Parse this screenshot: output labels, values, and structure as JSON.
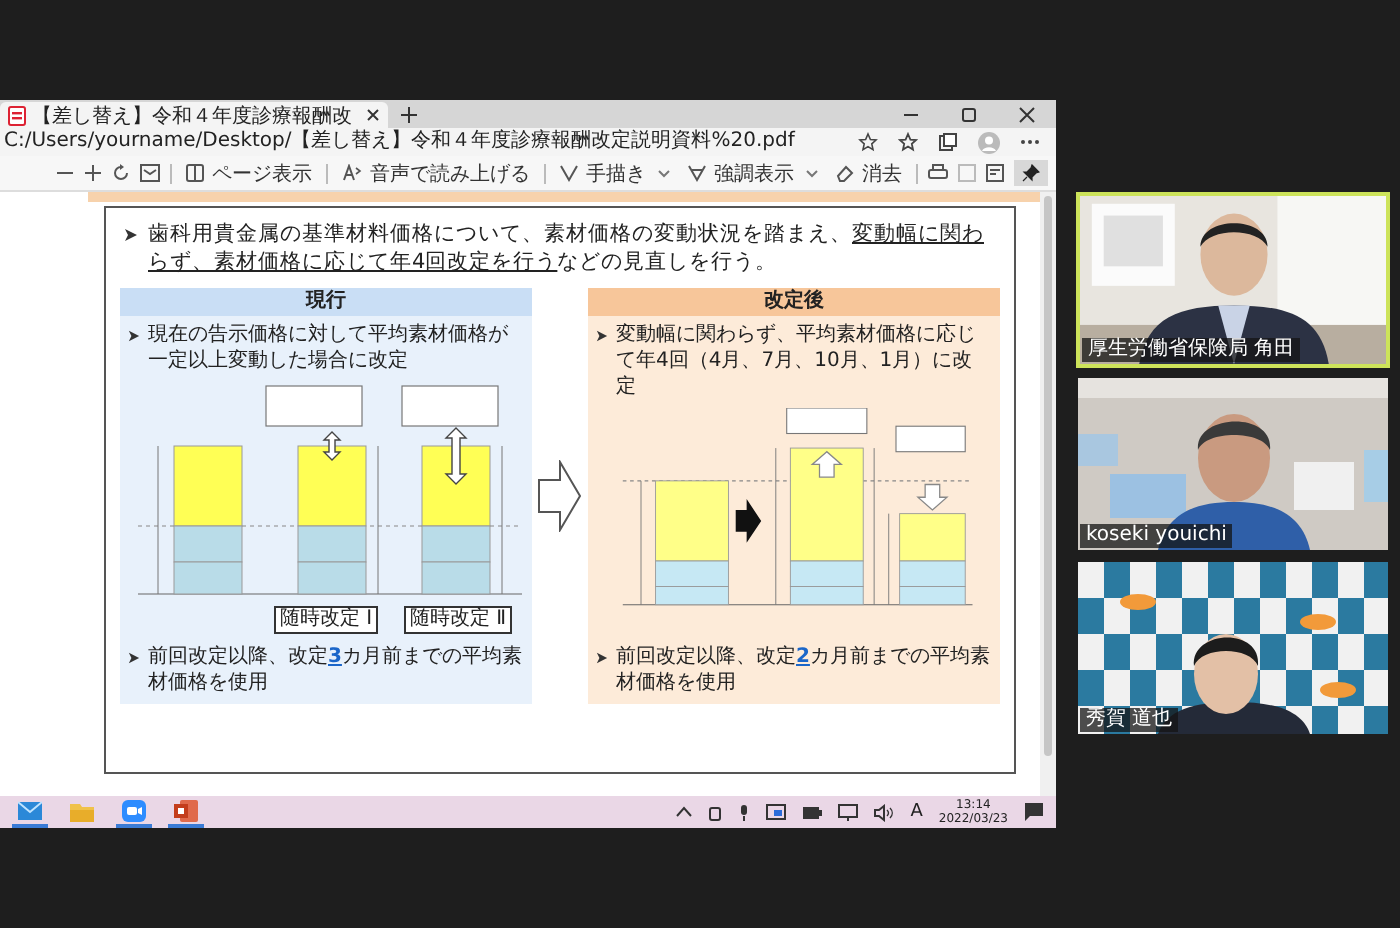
{
  "browser": {
    "tab_title": "【差し替え】令和４年度診療報酬改",
    "address": "C:/Users/yourname/Desktop/【差し替え】令和４年度診療報酬改定説明資料%20.pdf"
  },
  "pdf_toolbar": {
    "labels": [
      "ページ表示",
      "音声で読み上げる",
      "手描き",
      "強調表示",
      "消去"
    ],
    "pinned": true
  },
  "slide": {
    "intro": [
      {
        "text": "歯科用貴金属の基準材料価格について、素材価格の変動状況を踏まえ、",
        "underline": false
      },
      {
        "text": "変動幅に関わらず、素材価格に応じて年4回改定を行う",
        "underline": true
      },
      {
        "text": "などの見直しを行う。",
        "underline": false
      }
    ],
    "panels": [
      {
        "kind": "current",
        "title": "現行",
        "bullet": "現在の告示価格に対して平均素材価格が一定以上変動した場合に改定",
        "labels": [
          "随時改定 Ⅰ",
          "随時改定 Ⅱ"
        ],
        "footer": [
          {
            "text": "前回改定以降、改定",
            "emph": false
          },
          {
            "text": "3",
            "emph": true
          },
          {
            "text": "カ月前までの平均素材価格を使用",
            "emph": false
          }
        ]
      },
      {
        "kind": "revised",
        "title": "改定後",
        "bullet": "変動幅に関わらず、平均素材価格に応じて年4回（4月、7月、10月、1月）に改定",
        "footer": [
          {
            "text": "前回改定以降、改定",
            "emph": false
          },
          {
            "text": "2",
            "emph": true
          },
          {
            "text": "カ月前までの平均素材価格を使用",
            "emph": false
          }
        ]
      }
    ]
  },
  "participants": [
    {
      "name": "厚生労働省保険局 角田",
      "speaking": true
    },
    {
      "name": "koseki youichi",
      "speaking": false
    },
    {
      "name": "秀賀 道也",
      "speaking": false
    }
  ],
  "taskbar": {
    "apps": [
      {
        "running": true
      },
      {
        "running": false
      },
      {
        "running": true
      },
      {
        "running": true
      }
    ],
    "ime": "A",
    "time": "13:14",
    "date": "2022/03/23"
  }
}
